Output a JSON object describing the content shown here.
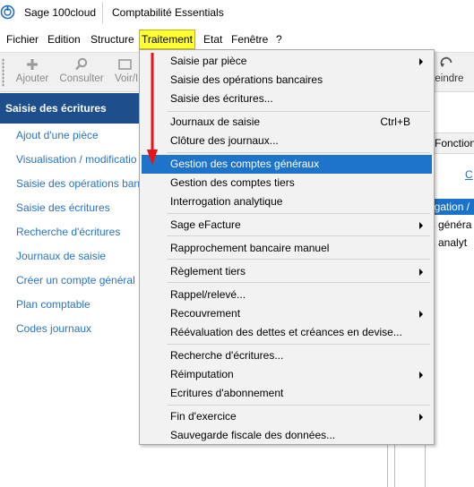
{
  "title_bar": {
    "app_name": "Sage 100cloud",
    "module": "Comptabilité Essentials"
  },
  "menu_bar": [
    "Fichier",
    "Edition",
    "Structure",
    "Traitement",
    "Etat",
    "Fenêtre",
    "?"
  ],
  "toolbar": {
    "buttons": [
      "Ajouter",
      "Consulter",
      "Voir/I"
    ],
    "right_partial": "tteindre"
  },
  "left_panel": {
    "header": "Saisie des écritures",
    "links": [
      "Ajout d'une pièce",
      "Visualisation / modificatio",
      "Saisie des opérations banc",
      "Saisie des écritures",
      "Recherche d'écritures",
      "Journaux de saisie",
      "Créer un compte général",
      "Plan comptable",
      "Codes journaux"
    ]
  },
  "right_panel": {
    "tab": "Fonction",
    "link": "C",
    "header": "ogation /",
    "items": [
      "ls généra",
      "ls analyt"
    ]
  },
  "dropdown": {
    "items": [
      {
        "label": "Saisie par pièce",
        "submenu": true
      },
      {
        "label": "Saisie des opérations bancaires"
      },
      {
        "label": "Saisie des écritures..."
      },
      {
        "label": "Journaux de saisie",
        "shortcut": "Ctrl+B"
      },
      {
        "label": "Clôture des journaux..."
      },
      {
        "label": "Gestion des comptes généraux",
        "highlighted": true
      },
      {
        "label": "Gestion des comptes tiers"
      },
      {
        "label": "Interrogation analytique"
      },
      {
        "label": "Sage eFacture",
        "submenu": true
      },
      {
        "label": "Rapprochement bancaire manuel"
      },
      {
        "label": "Règlement tiers",
        "submenu": true
      },
      {
        "label": "Rappel/relevé..."
      },
      {
        "label": "Recouvrement",
        "submenu": true
      },
      {
        "label": "Réévaluation des dettes et créances en devise..."
      },
      {
        "label": "Recherche d'écritures..."
      },
      {
        "label": "Réimputation",
        "submenu": true
      },
      {
        "label": "Ecritures d'abonnement"
      },
      {
        "label": "Fin d'exercice",
        "submenu": true
      },
      {
        "label": "Sauvegarde fiscale des données..."
      }
    ]
  },
  "colors": {
    "menu_highlight": "#ffff33",
    "selection": "#1e74c8",
    "left_header": "#1e4e8c",
    "link": "#2a73c0",
    "arrow": "#e8141a"
  }
}
